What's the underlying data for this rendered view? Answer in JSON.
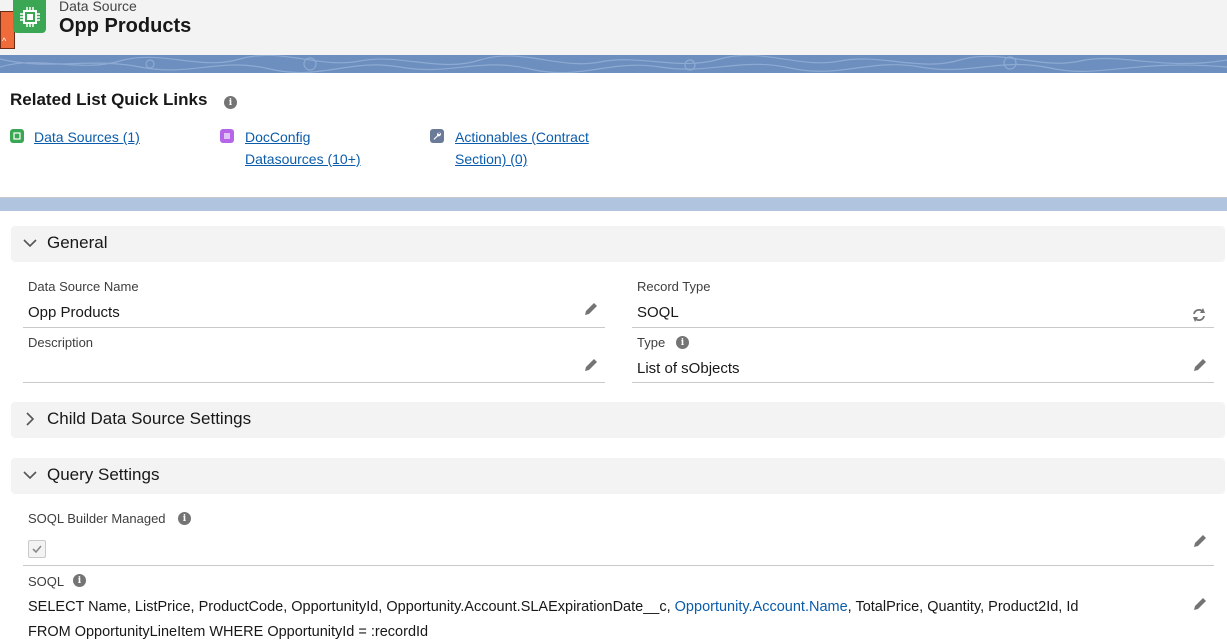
{
  "header": {
    "subtitle": "Data Source",
    "title": "Opp Products"
  },
  "quick_links": {
    "title": "Related List Quick Links",
    "items": [
      {
        "line1": "Data Sources (1)",
        "line2": "",
        "icon": "data-source-icon",
        "color": "#3ba755"
      },
      {
        "line1": "DocConfig",
        "line2": "Datasources (10+)",
        "icon": "docconfig-icon",
        "color": "#b566e8"
      },
      {
        "line1": "Actionables (Contract",
        "line2": "Section) (0)",
        "icon": "wrench-icon",
        "color": "#6b7a99"
      }
    ]
  },
  "sections": {
    "general": {
      "title": "General",
      "fields": {
        "name_label": "Data Source Name",
        "name_value": "Opp Products",
        "record_type_label": "Record Type",
        "record_type_value": "SOQL",
        "description_label": "Description",
        "description_value": "",
        "type_label": "Type",
        "type_value": "List of sObjects"
      }
    },
    "child": {
      "title": "Child Data Source Settings"
    },
    "query": {
      "title": "Query Settings",
      "soql_builder_label": "SOQL Builder Managed",
      "soql_builder_checked": true,
      "soql_label": "SOQL",
      "soql_part1": "SELECT Name, ListPrice, ProductCode, OpportunityId, Opportunity.Account.SLAExpirationDate__c, ",
      "soql_link": "Opportunity.Account.Name",
      "soql_part2": ", TotalPrice, Quantity, Product2Id, Id",
      "soql_line2": "FROM OpportunityLineItem WHERE OpportunityId = :recordId"
    }
  },
  "colors": {
    "accent_link": "#0b5cab",
    "object_icon": "#3ba755",
    "orange_tab": "#f06b3a"
  }
}
